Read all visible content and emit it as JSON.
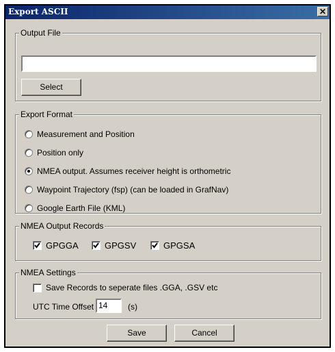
{
  "window": {
    "title": "Export ASCII",
    "close_label": "✕"
  },
  "output_file": {
    "legend": "Output File",
    "path_value": "",
    "select_label": "Select"
  },
  "export_format": {
    "legend": "Export Format",
    "selected_index": 2,
    "options": [
      "Measurement and Position",
      "Position only",
      "NMEA output.  Assumes receiver height is orthometric",
      "Waypoint Trajectory (fsp) (can be loaded in GrafNav)",
      "Google Earth File (KML)"
    ]
  },
  "nmea_records": {
    "legend": "NMEA Output Records",
    "items": [
      {
        "label": "GPGGA",
        "checked": true
      },
      {
        "label": "GPGSV",
        "checked": true
      },
      {
        "label": "GPGSA",
        "checked": true
      }
    ]
  },
  "nmea_settings": {
    "legend": "NMEA Settings",
    "separate_files_label": "Save Records to seperate files .GGA, .GSV etc",
    "separate_files_checked": false,
    "utc_offset_label": "UTC Time Offset",
    "utc_offset_value": "14",
    "utc_offset_unit": "(s)"
  },
  "footer": {
    "save_label": "Save",
    "cancel_label": "Cancel"
  }
}
